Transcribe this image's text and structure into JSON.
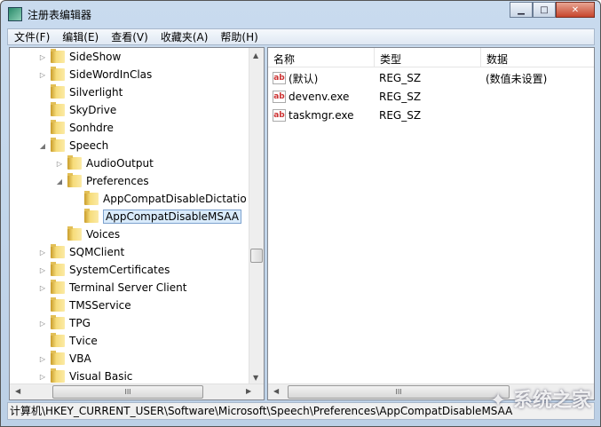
{
  "window": {
    "title": "注册表编辑器",
    "minimize": "▁",
    "maximize": "□",
    "close": "✕"
  },
  "menu": [
    "文件(F)",
    "编辑(E)",
    "查看(V)",
    "收藏夹(A)",
    "帮助(H)"
  ],
  "tree": [
    {
      "label": "SideShow",
      "level": 1,
      "exp": "▷"
    },
    {
      "label": "SideWordInClas",
      "level": 1,
      "exp": "▷"
    },
    {
      "label": "Silverlight",
      "level": 1,
      "exp": ""
    },
    {
      "label": "SkyDrive",
      "level": 1,
      "exp": ""
    },
    {
      "label": "Sonhdre",
      "level": 1,
      "exp": ""
    },
    {
      "label": "Speech",
      "level": 1,
      "exp": "◢"
    },
    {
      "label": "AudioOutput",
      "level": 2,
      "exp": "▷"
    },
    {
      "label": "Preferences",
      "level": 2,
      "exp": "◢"
    },
    {
      "label": "AppCompatDisableDictatio",
      "level": 3,
      "exp": ""
    },
    {
      "label": "AppCompatDisableMSAA",
      "level": 3,
      "exp": "",
      "selected": true
    },
    {
      "label": "Voices",
      "level": 2,
      "exp": ""
    },
    {
      "label": "SQMClient",
      "level": 1,
      "exp": "▷"
    },
    {
      "label": "SystemCertificates",
      "level": 1,
      "exp": "▷"
    },
    {
      "label": "Terminal Server Client",
      "level": 1,
      "exp": "▷"
    },
    {
      "label": "TMSService",
      "level": 1,
      "exp": ""
    },
    {
      "label": "TPG",
      "level": 1,
      "exp": "▷"
    },
    {
      "label": "Tvice",
      "level": 1,
      "exp": ""
    },
    {
      "label": "VBA",
      "level": 1,
      "exp": "▷"
    },
    {
      "label": "Visual Basic",
      "level": 1,
      "exp": "▷"
    }
  ],
  "list": {
    "headers": [
      "名称",
      "类型",
      "数据"
    ],
    "rows": [
      {
        "name": "(默认)",
        "type": "REG_SZ",
        "data": "(数值未设置)"
      },
      {
        "name": "devenv.exe",
        "type": "REG_SZ",
        "data": ""
      },
      {
        "name": "taskmgr.exe",
        "type": "REG_SZ",
        "data": ""
      }
    ],
    "icon_text": "ab"
  },
  "scroll": {
    "grip": "III"
  },
  "status": "计算机\\HKEY_CURRENT_USER\\Software\\Microsoft\\Speech\\Preferences\\AppCompatDisableMSAA",
  "watermark": "系统之家"
}
